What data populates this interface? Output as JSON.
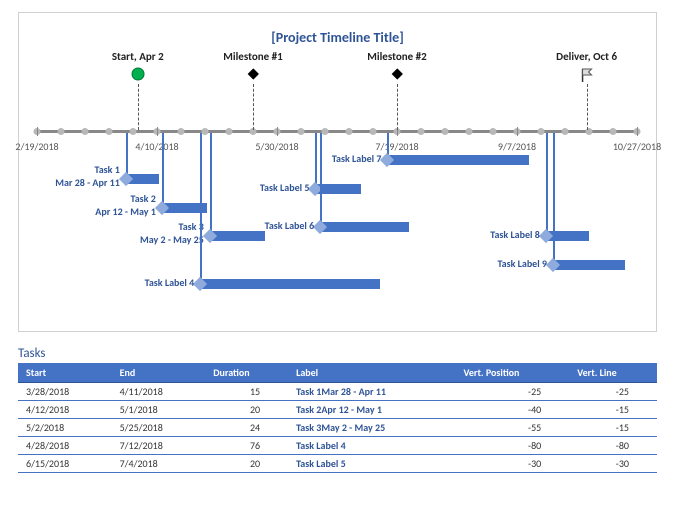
{
  "chart_data": {
    "type": "gantt-timeline",
    "title": "[Project Timeline Title]",
    "x_axis": {
      "ticks": [
        "2/19/2018",
        "4/10/2018",
        "5/30/2018",
        "7/19/2018",
        "9/7/2018",
        "10/27/2018"
      ],
      "range_num": [
        43150,
        43400
      ]
    },
    "milestones": [
      {
        "label": "Start, Apr 2",
        "date": "4/2/2018",
        "date_num": 43192,
        "marker": "green-dot"
      },
      {
        "label": "Milestone #1",
        "date": "5/20/2018",
        "date_num": 43240,
        "marker": "black-diamond"
      },
      {
        "label": "Milestone #2",
        "date": "7/19/2018",
        "date_num": 43300,
        "marker": "black-diamond"
      },
      {
        "label": "Deliver, Oct 6",
        "date": "10/6/2018",
        "date_num": 43379,
        "marker": "flag"
      }
    ],
    "tasks": [
      {
        "label": "Task 1",
        "sublabel": "Mar 28 - Apr 11",
        "start_num": 43187,
        "end_num": 43201,
        "vert": -25
      },
      {
        "label": "Task 2",
        "sublabel": "Apr 12 - May 1",
        "start_num": 43202,
        "end_num": 43221,
        "vert": -40
      },
      {
        "label": "Task 3",
        "sublabel": "May 2 - May 25",
        "start_num": 43222,
        "end_num": 43245,
        "vert": -55
      },
      {
        "label": "Task Label 4",
        "sublabel": "",
        "start_num": 43218,
        "end_num": 43293,
        "vert": -80
      },
      {
        "label": "Task Label 5",
        "sublabel": "",
        "start_num": 43266,
        "end_num": 43285,
        "vert": -30
      },
      {
        "label": "Task Label 6",
        "sublabel": "",
        "start_num": 43268,
        "end_num": 43305,
        "vert": -50
      },
      {
        "label": "Task Label 7",
        "sublabel": "",
        "start_num": 43296,
        "end_num": 43355,
        "vert": -15
      },
      {
        "label": "Task Label 8",
        "sublabel": "",
        "start_num": 43362,
        "end_num": 43380,
        "vert": -55
      },
      {
        "label": "Task Label 9",
        "sublabel": "",
        "start_num": 43365,
        "end_num": 43395,
        "vert": -70
      }
    ]
  },
  "table": {
    "title": "Tasks",
    "headers": [
      "Start",
      "End",
      "Duration",
      "Label",
      "Vert. Position",
      "Vert. Line"
    ],
    "rows": [
      {
        "start": "3/28/2018",
        "end": "4/11/2018",
        "duration": 15,
        "label": "Task 1Mar 28 - Apr 11",
        "vpos": -25,
        "vline": -25
      },
      {
        "start": "4/12/2018",
        "end": "5/1/2018",
        "duration": 20,
        "label": "Task 2Apr 12 - May 1",
        "vpos": -40,
        "vline": -15
      },
      {
        "start": "5/2/2018",
        "end": "5/25/2018",
        "duration": 24,
        "label": "Task 3May 2 - May 25",
        "vpos": -55,
        "vline": -15
      },
      {
        "start": "4/28/2018",
        "end": "7/12/2018",
        "duration": 76,
        "label": "Task Label 4",
        "vpos": -80,
        "vline": -80
      },
      {
        "start": "6/15/2018",
        "end": "7/4/2018",
        "duration": 20,
        "label": "Task Label 5",
        "vpos": -30,
        "vline": -30
      }
    ]
  }
}
